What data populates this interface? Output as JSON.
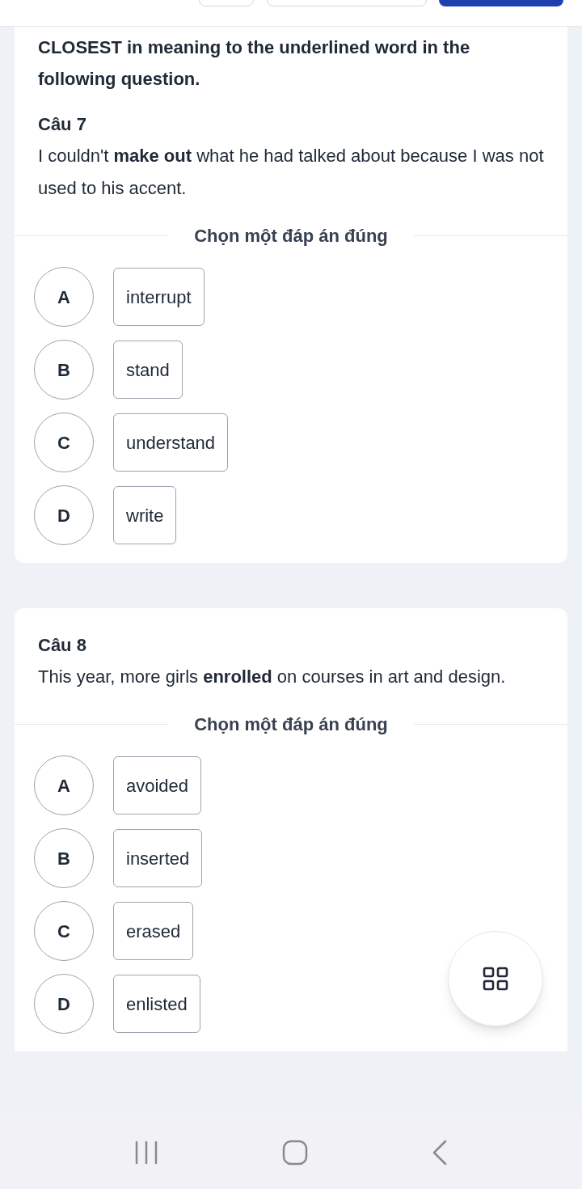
{
  "questions": [
    {
      "intro": "CLOSEST in meaning to the underlined word in the following question.",
      "number": "Câu 7",
      "text": "I couldn't **make out** what he had talked about because I was not used to his accent.",
      "prompt": "Chọn một đáp án đúng",
      "options": [
        {
          "letter": "A",
          "text": "interrupt",
          "selected": false
        },
        {
          "letter": "B",
          "text": "stand",
          "selected": false
        },
        {
          "letter": "C",
          "text": "understand",
          "selected": false
        },
        {
          "letter": "D",
          "text": "write",
          "selected": false
        }
      ]
    },
    {
      "number": "Câu 8",
      "text": "This year, more girls **enrolled** on courses in art and design.",
      "prompt": "Chọn một đáp án đúng",
      "options": [
        {
          "letter": "A",
          "text": "avoided",
          "selected": false
        },
        {
          "letter": "B",
          "text": "inserted",
          "selected": false
        },
        {
          "letter": "C",
          "text": "erased",
          "selected": false
        },
        {
          "letter": "D",
          "text": "enlisted",
          "selected": false
        }
      ]
    }
  ]
}
